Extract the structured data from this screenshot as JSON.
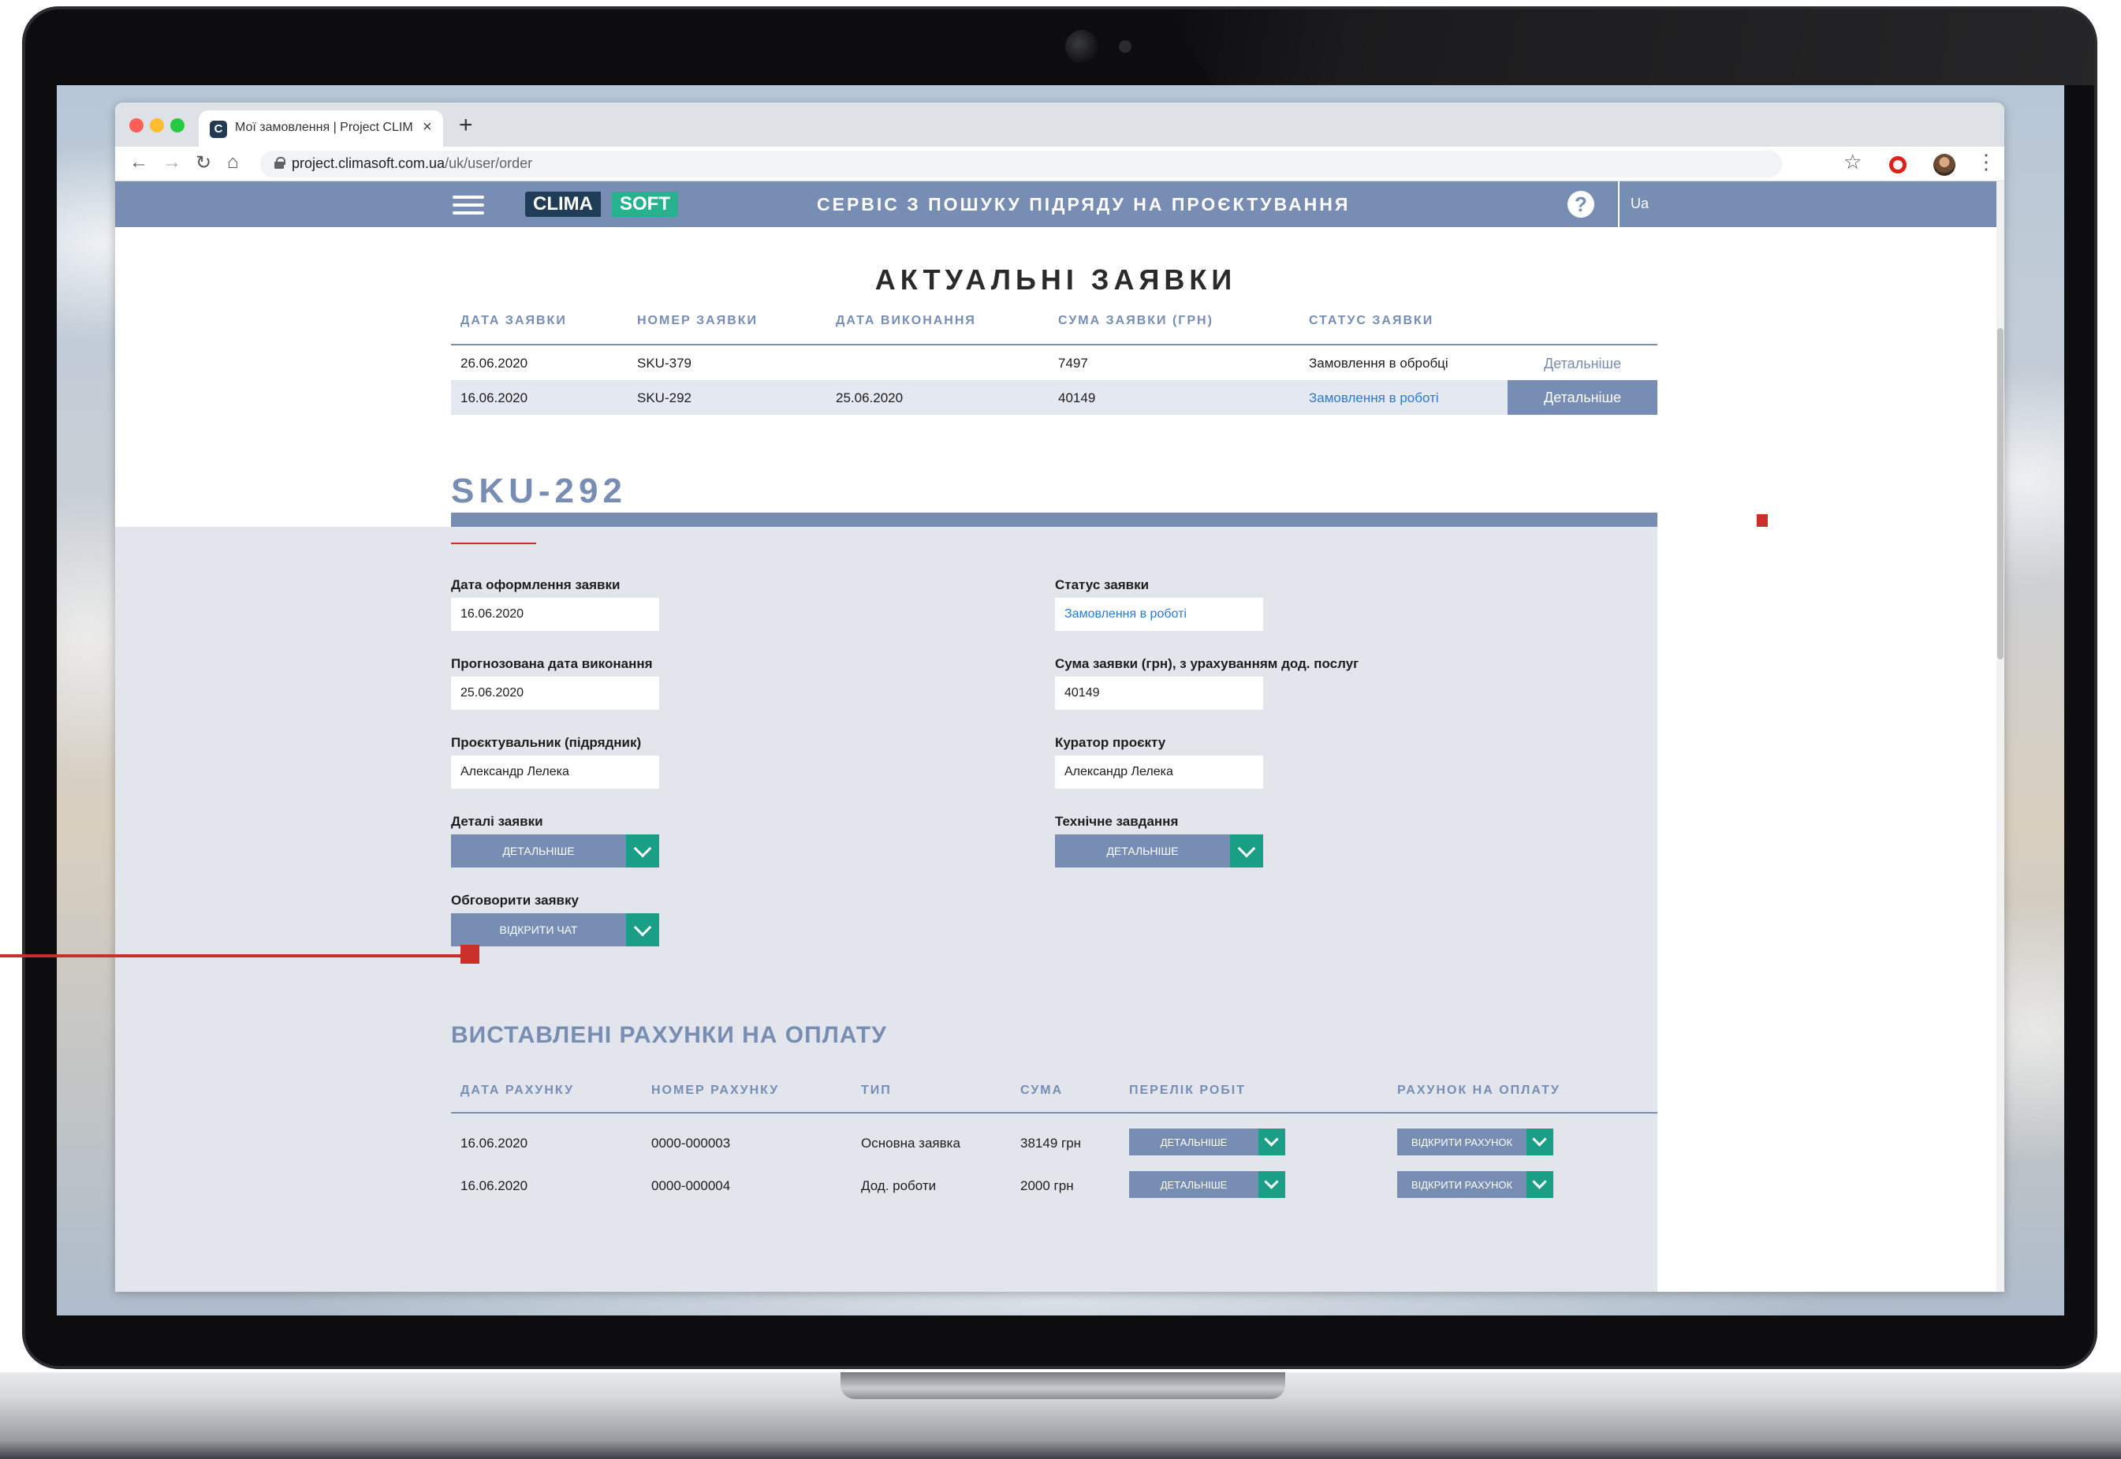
{
  "browser": {
    "tab_title": "Мої замовлення | Project CLIMASOFT",
    "tab_close": "×",
    "new_tab": "+",
    "url_host": "project.climasoft.com.ua",
    "url_path": "/uk/user/order",
    "favicon_letter": "C"
  },
  "header": {
    "logo_left": "CLIMA",
    "logo_right": "SOFT",
    "title": "СЕРВІС З ПОШУКУ ПІДРЯДУ НА ПРОЄКТУВАННЯ",
    "help": "?",
    "lang": "Ua"
  },
  "page_title": "АКТУАЛЬНІ ЗАЯВКИ",
  "orders": {
    "columns": [
      "ДАТА ЗАЯВКИ",
      "НОМЕР ЗАЯВКИ",
      "ДАТА ВИКОНАННЯ",
      "СУМА ЗАЯВКИ (ГРН)",
      "СТАТУС ЗАЯВКИ"
    ],
    "rows": [
      {
        "date": "26.06.2020",
        "number": "SKU-379",
        "done": "",
        "sum": "7497",
        "status": "Замовлення в обробці",
        "action": "Детальніше"
      },
      {
        "date": "16.06.2020",
        "number": "SKU-292",
        "done": "25.06.2020",
        "sum": "40149",
        "status": "Замовлення в роботі",
        "action": "Детальніше"
      }
    ]
  },
  "order": {
    "title": "SKU-292",
    "fields": {
      "created_label": "Дата оформлення заявки",
      "created_value": "16.06.2020",
      "forecast_label": "Прогнозована дата виконання",
      "forecast_value": "25.06.2020",
      "designer_label": "Проєктувальник (підрядник)",
      "designer_value": "Александр Лелека",
      "details_label": "Деталі заявки",
      "details_button": "ДЕТАЛЬНІШЕ",
      "discuss_label": "Обговорити заявку",
      "chat_button": "ВІДКРИТИ ЧАТ",
      "status_label": "Статус заявки",
      "status_value": "Замовлення в роботі",
      "sum_label": "Сума заявки (грн), з урахуванням дод. послуг",
      "sum_value": "40149",
      "curator_label": "Куратор проєкту",
      "curator_value": "Александр Лелека",
      "spec_label": "Технічне завдання",
      "spec_button": "ДЕТАЛЬНІШЕ"
    }
  },
  "invoices": {
    "title": "ВИСТАВЛЕНІ РАХУНКИ НА ОПЛАТУ",
    "columns": [
      "ДАТА РАХУНКУ",
      "НОМЕР РАХУНКУ",
      "ТИП",
      "СУМА",
      "ПЕРЕЛІК РОБІТ",
      "РАХУНОК НА ОПЛАТУ"
    ],
    "rows": [
      {
        "date": "16.06.2020",
        "number": "0000-000003",
        "type": "Основна заявка",
        "sum": "38149 грн",
        "works": "ДЕТАЛЬНІШЕ",
        "invoice": "ВІДКРИТИ РАХУНОК"
      },
      {
        "date": "16.06.2020",
        "number": "0000-000004",
        "type": "Дод. роботи",
        "sum": "2000 грн",
        "works": "ДЕТАЛЬНІШЕ",
        "invoice": "ВІДКРИТИ РАХУНОК"
      }
    ]
  },
  "colors": {
    "brand_blue": "#778db3",
    "brand_green": "#1a9e86",
    "accent_red": "#c9302c",
    "link_blue": "#2a7bd6"
  }
}
